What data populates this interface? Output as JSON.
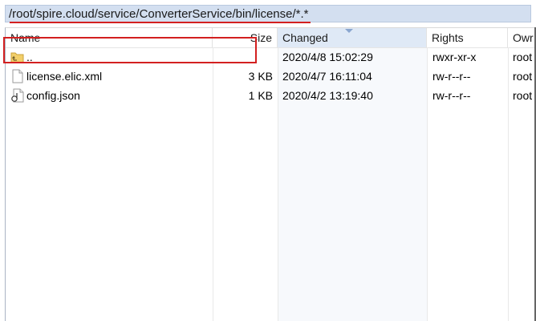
{
  "path": {
    "text": "/root/spire.cloud/service/ConverterService/bin/license/*.*"
  },
  "columns": {
    "name": "Name",
    "size": "Size",
    "changed": "Changed",
    "rights": "Rights",
    "owner": "Owr"
  },
  "files": [
    {
      "name": "..",
      "size": "",
      "changed": "2020/4/8 15:02:29",
      "rights": "rwxr-xr-x",
      "owner": "root",
      "icon": "parent-folder-icon"
    },
    {
      "name": "license.elic.xml",
      "size": "3 KB",
      "changed": "2020/4/7 16:11:04",
      "rights": "rw-r--r--",
      "owner": "root",
      "icon": "file-icon"
    },
    {
      "name": "config.json",
      "size": "1 KB",
      "changed": "2020/4/2 13:19:40",
      "rights": "rw-r--r--",
      "owner": "root",
      "icon": "json-file-icon"
    }
  ],
  "colors": {
    "annotation_red": "#d32020",
    "sorted_header": "#dfe9f6",
    "path_bg": "#d3dff0"
  }
}
